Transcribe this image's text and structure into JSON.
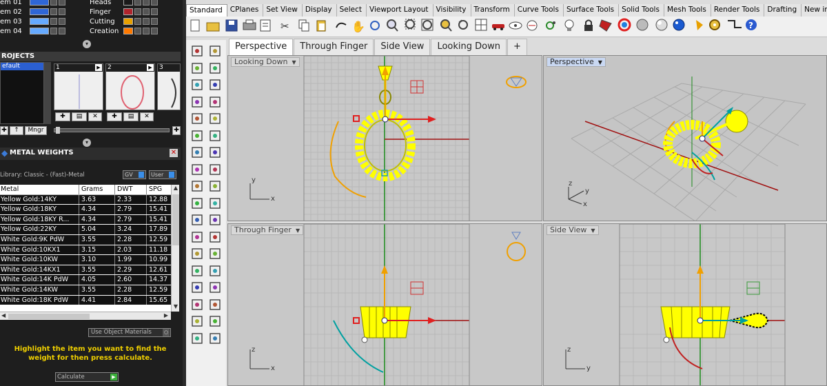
{
  "layers": [
    {
      "name": "em 01",
      "color": "#2f66d6"
    },
    {
      "name": "em 02",
      "color": "#2f66d6"
    },
    {
      "name": "em 03",
      "color": "#66aaff"
    },
    {
      "name": "em 04",
      "color": "#66aaff"
    }
  ],
  "layers_right": [
    {
      "name": "Heads",
      "color": "#1a1a1a"
    },
    {
      "name": "Finger",
      "color": "#b0242c"
    },
    {
      "name": "Cutting",
      "color": "#e8a000"
    },
    {
      "name": "Creation",
      "color": "#ff7a00"
    }
  ],
  "projects": {
    "header": "ROJECTS",
    "default_item": "efault",
    "thumb_numbers": [
      "1",
      "2",
      "3"
    ],
    "mngr_label": "Mngr"
  },
  "metal_weights": {
    "header": "METAL WEIGHTS",
    "library": "Library: Classic - (Fast)-Metal",
    "gv_label": "GV",
    "user_label": "User",
    "columns": [
      "Metal",
      "Grams",
      "DWT",
      "SPG"
    ],
    "rows": [
      [
        "Yellow Gold:14KY",
        "3.63",
        "2.33",
        "12.88"
      ],
      [
        "Yellow Gold:18KY",
        "4.34",
        "2.79",
        "15.41"
      ],
      [
        "Yellow Gold:18KY R...",
        "4.34",
        "2.79",
        "15.41"
      ],
      [
        "Yellow Gold:22KY",
        "5.04",
        "3.24",
        "17.89"
      ],
      [
        "White Gold:9K PdW",
        "3.55",
        "2.28",
        "12.59"
      ],
      [
        "White Gold:10KX1",
        "3.15",
        "2.03",
        "11.18"
      ],
      [
        "White Gold:10KW",
        "3.10",
        "1.99",
        "10.99"
      ],
      [
        "White Gold:14KX1",
        "3.55",
        "2.29",
        "12.61"
      ],
      [
        "White Gold:14K PdW",
        "4.05",
        "2.60",
        "14.37"
      ],
      [
        "White Gold:14KW",
        "3.55",
        "2.28",
        "12.59"
      ],
      [
        "White Gold:18K PdW",
        "4.41",
        "2.84",
        "15.65"
      ]
    ],
    "use_object_materials": "Use Object Materials",
    "instruction": "Highlight the item you want to find the weight for then press calculate.",
    "calculate_value": "Calculate"
  },
  "toolbar_tabs": [
    "Standard",
    "CPlanes",
    "Set View",
    "Display",
    "Select",
    "Viewport Layout",
    "Visibility",
    "Transform",
    "Curve Tools",
    "Surface Tools",
    "Solid Tools",
    "Mesh Tools",
    "Render Tools",
    "Drafting",
    "New in V5"
  ],
  "viewport_tabs": [
    "Perspective",
    "Through Finger",
    "Side View",
    "Looking Down"
  ],
  "viewport_tab_add": "+",
  "viewports": {
    "top_left": "Looking Down",
    "top_right": "Perspective",
    "bottom_left": "Through Finger",
    "bottom_right": "Side View"
  },
  "axis_labels": {
    "x": "x",
    "y": "y",
    "z": "z"
  },
  "colors": {
    "accent_yellow": "#ffff00",
    "accent_orange": "#f0a000",
    "axis_red": "#c00000",
    "axis_green": "#00a000",
    "cyan": "#009aa0",
    "instruction": "#f0d000"
  }
}
